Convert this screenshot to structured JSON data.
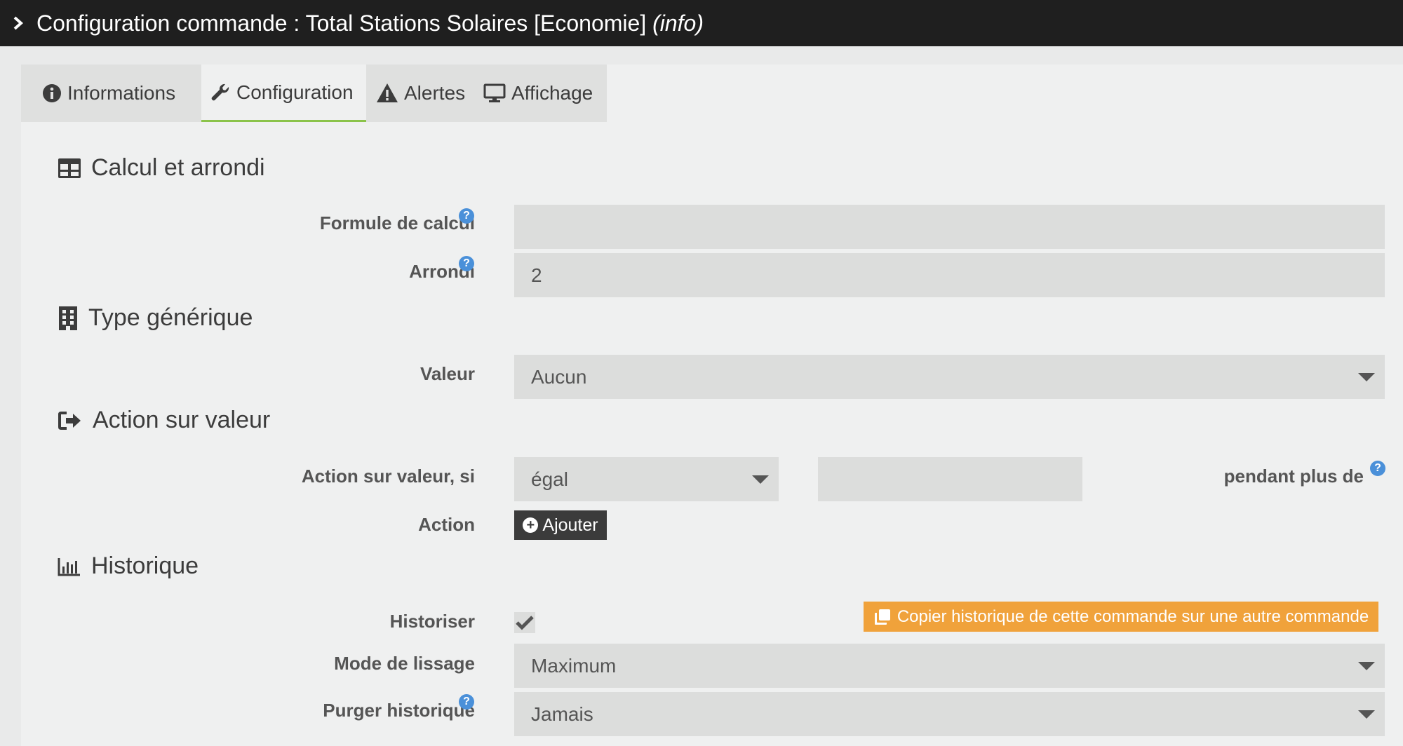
{
  "header": {
    "title_prefix": "Configuration commande : Total Stations Solaires [Economie]",
    "title_type": "(info)"
  },
  "tabs": [
    {
      "label": "Informations",
      "icon": "info-circle-icon"
    },
    {
      "label": "Configuration",
      "icon": "wrench-icon",
      "active": true
    },
    {
      "label": "Alertes",
      "icon": "warning-icon"
    },
    {
      "label": "Affichage",
      "icon": "monitor-icon"
    }
  ],
  "sections": {
    "calcul": {
      "title": "Calcul et arrondi",
      "formule_label": "Formule de calcul",
      "formule_value": "",
      "arrondi_label": "Arrondi",
      "arrondi_value": "2"
    },
    "type": {
      "title": "Type générique",
      "valeur_label": "Valeur",
      "valeur_selected": "Aucun"
    },
    "action": {
      "title": "Action sur valeur",
      "condition_label": "Action sur valeur, si",
      "operator_selected": "égal",
      "compare_value": "",
      "pendant_label": "pendant plus de",
      "action_label": "Action",
      "ajouter_label": "Ajouter"
    },
    "historique": {
      "title": "Historique",
      "historiser_label": "Historiser",
      "historiser_checked": true,
      "copier_label": "Copier historique de cette commande sur une autre commande",
      "lissage_label": "Mode de lissage",
      "lissage_selected": "Maximum",
      "purger_label": "Purger historique",
      "purger_selected": "Jamais"
    }
  },
  "help_glyph": "?",
  "colors": {
    "accent_green": "#8bc34a",
    "help_blue": "#4a90d9",
    "orange_button": "#f0a23b",
    "dark_button": "#3b3b3b",
    "titlebar": "#1f1f1f"
  }
}
